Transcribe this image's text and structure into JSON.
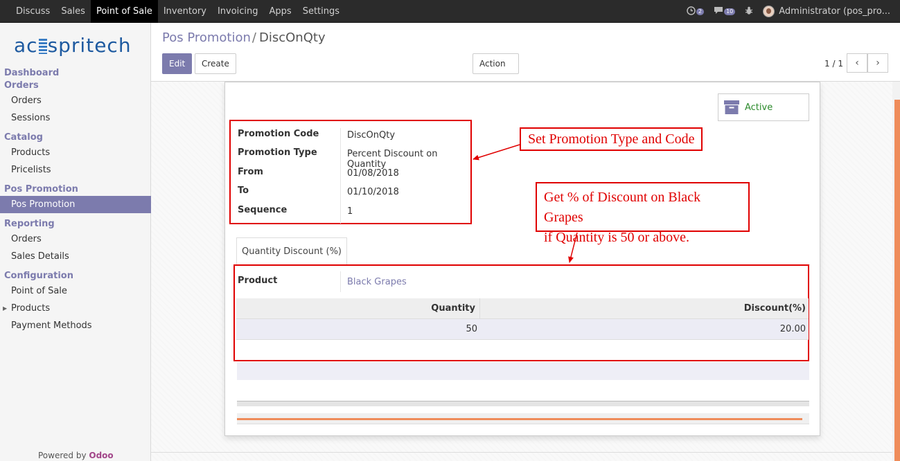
{
  "topbar": {
    "menu": [
      "Discuss",
      "Sales",
      "Point of Sale",
      "Inventory",
      "Invoicing",
      "Apps",
      "Settings"
    ],
    "activity_count": "2",
    "message_count": "10",
    "user": "Administrator (pos_pro..."
  },
  "sidebar": {
    "logo_left": "ac",
    "logo_right": "spritech",
    "sections": {
      "dashboard": "Dashboard",
      "orders": "Orders",
      "orders_items": [
        "Orders",
        "Sessions"
      ],
      "catalog": "Catalog",
      "catalog_items": [
        "Products",
        "Pricelists"
      ],
      "pos_promotion": "Pos Promotion",
      "pos_promotion_items": [
        "Pos Promotion"
      ],
      "reporting": "Reporting",
      "reporting_items": [
        "Orders",
        "Sales Details"
      ],
      "configuration": "Configuration",
      "configuration_items": [
        "Point of Sale",
        "Products",
        "Payment Methods"
      ]
    },
    "powered_prefix": "Powered by ",
    "powered_brand": "Odoo"
  },
  "control_panel": {
    "breadcrumb_parent": "Pos Promotion",
    "breadcrumb_sep": "/",
    "breadcrumb_current": "DiscOnQty",
    "edit_label": "Edit",
    "create_label": "Create",
    "action_label": "Action",
    "pager": "1 / 1"
  },
  "form": {
    "status_label": "Active",
    "fields": [
      {
        "label": "Promotion Code",
        "value": "DiscOnQty"
      },
      {
        "label": "Promotion Type",
        "value": "Percent Discount on Quantity"
      },
      {
        "label": "From",
        "value": "01/08/2018"
      },
      {
        "label": "To",
        "value": "01/10/2018"
      },
      {
        "label": "Sequence",
        "value": "1"
      }
    ],
    "tab_label": "Quantity Discount (%)",
    "product_label": "Product",
    "product_value": "Black Grapes",
    "table": {
      "headers": [
        "Quantity",
        "Discount(%)"
      ],
      "rows": [
        [
          "50",
          "20.00"
        ]
      ]
    }
  },
  "annotations": {
    "callout1": "Set Promotion Type and Code",
    "callout2_line1": "Get % of Discount on Black Grapes",
    "callout2_line2": "if Quantity is 50 or above."
  },
  "colors": {
    "brand": "#7c7bad",
    "annotation": "#e00000",
    "active_status": "#2b8a2b",
    "odoo": "#a24689"
  }
}
